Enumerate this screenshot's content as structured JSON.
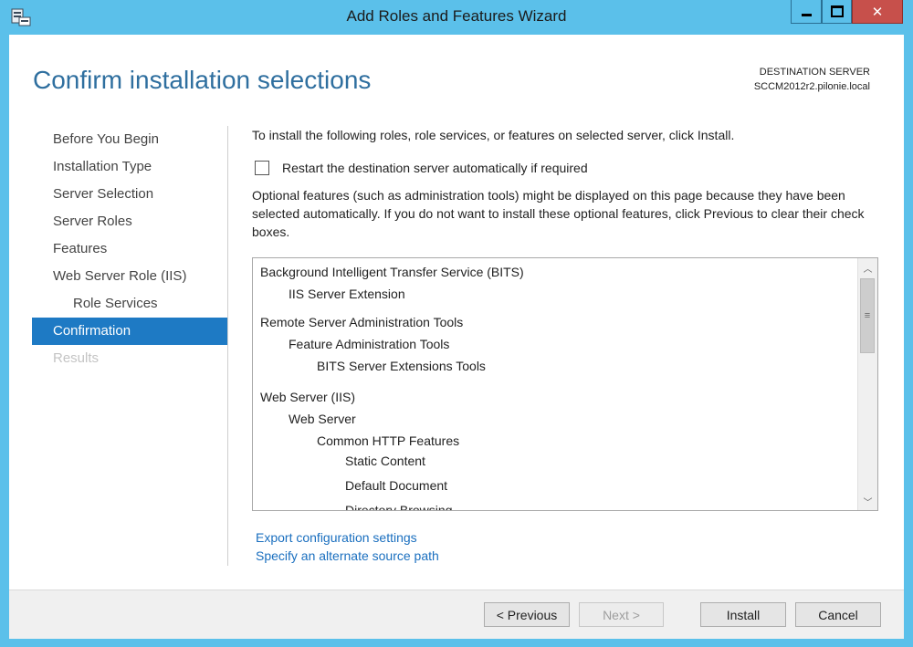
{
  "window": {
    "title": "Add Roles and Features Wizard",
    "icons": {
      "app": "server-manager-icon",
      "minimize": "minimize-icon",
      "maximize": "maximize-icon",
      "close": "close-icon"
    }
  },
  "header": {
    "page_title": "Confirm installation selections",
    "destination_label": "DESTINATION SERVER",
    "destination_server": "SCCM2012r2.pilonie.local"
  },
  "nav": {
    "items": [
      {
        "label": "Before You Begin",
        "state": "normal",
        "level": 0
      },
      {
        "label": "Installation Type",
        "state": "normal",
        "level": 0
      },
      {
        "label": "Server Selection",
        "state": "normal",
        "level": 0
      },
      {
        "label": "Server Roles",
        "state": "normal",
        "level": 0
      },
      {
        "label": "Features",
        "state": "normal",
        "level": 0
      },
      {
        "label": "Web Server Role (IIS)",
        "state": "normal",
        "level": 0
      },
      {
        "label": "Role Services",
        "state": "normal",
        "level": 1
      },
      {
        "label": "Confirmation",
        "state": "active",
        "level": 0
      },
      {
        "label": "Results",
        "state": "disabled",
        "level": 0
      }
    ]
  },
  "content": {
    "intro": "To install the following roles, role services, or features on selected server, click Install.",
    "restart_checkbox": {
      "label": "Restart the destination server automatically if required",
      "checked": false
    },
    "note": "Optional features (such as administration tools) might be displayed on this page because they have been selected automatically. If you do not want to install these optional features, click Previous to clear their check boxes.",
    "features": [
      {
        "label": "Background Intelligent Transfer Service (BITS)",
        "level": 0
      },
      {
        "label": "IIS Server Extension",
        "level": 1
      },
      {
        "label": "Remote Server Administration Tools",
        "level": 0
      },
      {
        "label": "Feature Administration Tools",
        "level": 1
      },
      {
        "label": "BITS Server Extensions Tools",
        "level": 2
      },
      {
        "label": "Web Server (IIS)",
        "level": 0
      },
      {
        "label": "Web Server",
        "level": 1
      },
      {
        "label": "Common HTTP Features",
        "level": 2
      },
      {
        "label": "Static Content",
        "level": 3
      },
      {
        "label": "Default Document",
        "level": 3
      },
      {
        "label": "Directory Browsing",
        "level": 3
      }
    ],
    "links": {
      "export": "Export configuration settings",
      "alternate_source": "Specify an alternate source path"
    }
  },
  "footer": {
    "previous": "< Previous",
    "next": "Next >",
    "install": "Install",
    "cancel": "Cancel"
  },
  "colors": {
    "accent": "#1e7ac4",
    "title_blue": "#2f6f9f",
    "frame": "#5bc0ea",
    "link": "#1a6fbf"
  }
}
